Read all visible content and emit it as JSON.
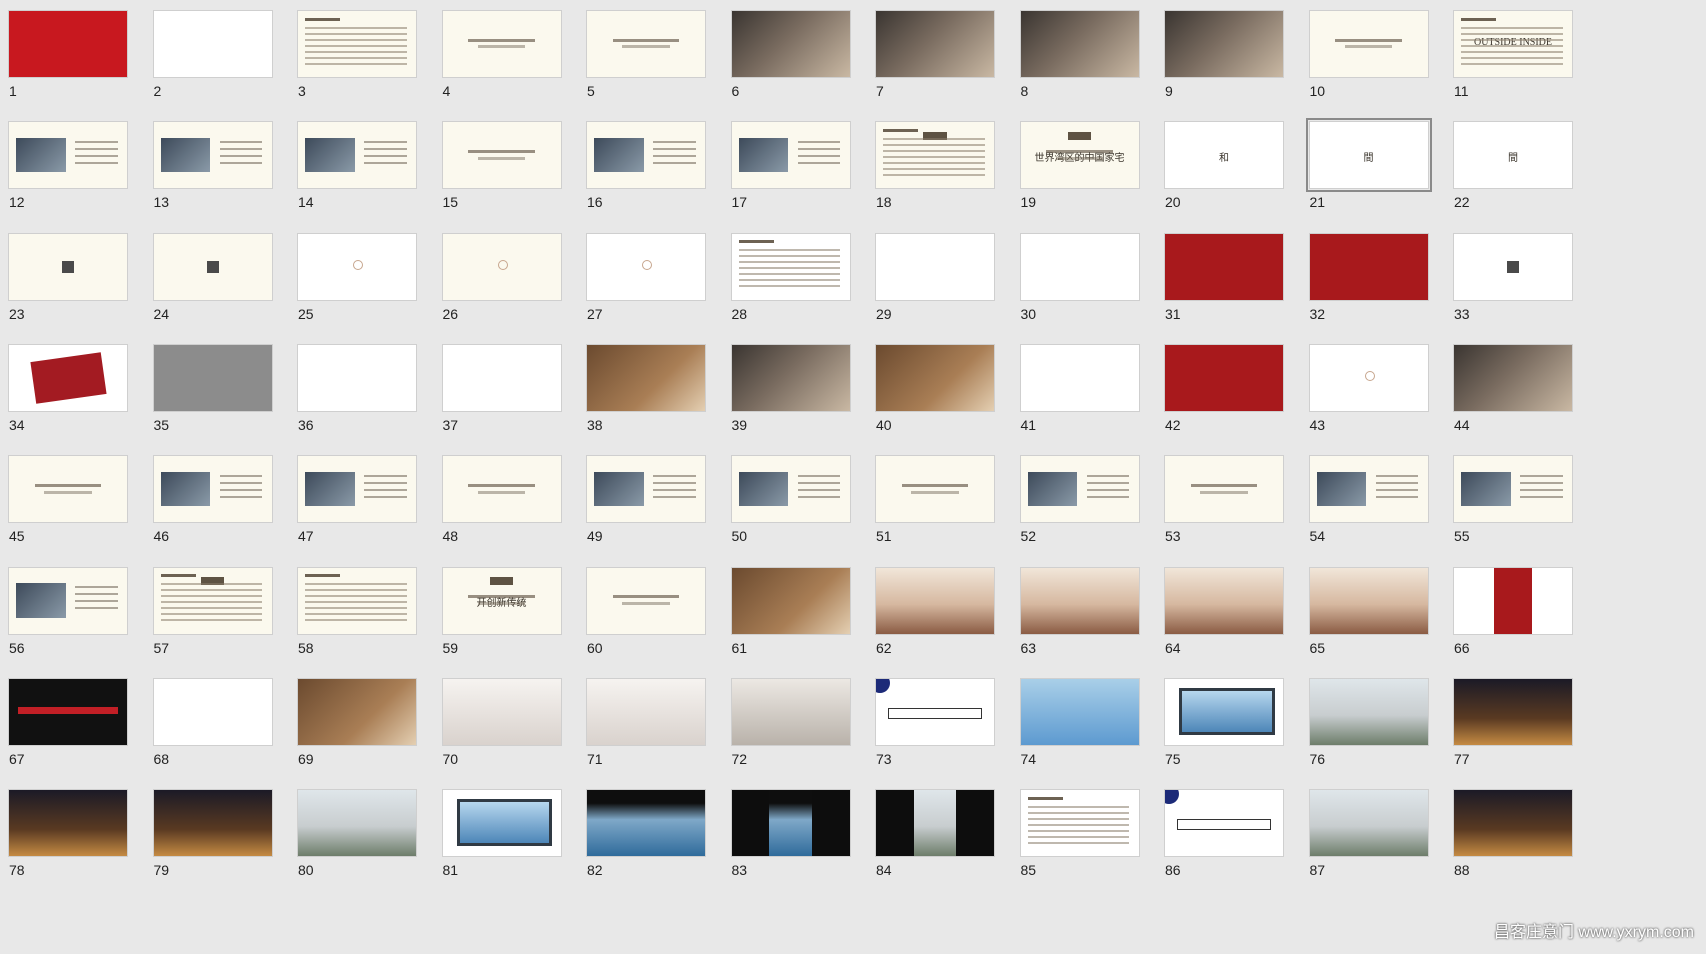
{
  "slides": [
    {
      "n": "1",
      "style": "red"
    },
    {
      "n": "2",
      "style": "white"
    },
    {
      "n": "3",
      "style": "doc"
    },
    {
      "n": "4",
      "style": "txt"
    },
    {
      "n": "5",
      "style": "txt"
    },
    {
      "n": "6",
      "style": "photo"
    },
    {
      "n": "7",
      "style": "photo"
    },
    {
      "n": "8",
      "style": "photo"
    },
    {
      "n": "9",
      "style": "photo"
    },
    {
      "n": "10",
      "style": "txt"
    },
    {
      "n": "11",
      "style": "doc",
      "text": "OUTSIDE INSIDE"
    },
    {
      "n": "12",
      "style": "pic"
    },
    {
      "n": "13",
      "style": "pic"
    },
    {
      "n": "14",
      "style": "pic"
    },
    {
      "n": "15",
      "style": "txt"
    },
    {
      "n": "16",
      "style": "pic"
    },
    {
      "n": "17",
      "style": "pic"
    },
    {
      "n": "18",
      "style": "doc",
      "tag": true
    },
    {
      "n": "19",
      "style": "txt",
      "tag": true,
      "text": "世界湾区的中国家宅"
    },
    {
      "n": "20",
      "style": "white",
      "text": "和"
    },
    {
      "n": "21",
      "style": "white",
      "text": "間",
      "selected": true
    },
    {
      "n": "22",
      "style": "white",
      "text": "間"
    },
    {
      "n": "23",
      "style": "icon"
    },
    {
      "n": "24",
      "style": "icon"
    },
    {
      "n": "25",
      "style": "mark white"
    },
    {
      "n": "26",
      "style": "mark"
    },
    {
      "n": "27",
      "style": "mark white"
    },
    {
      "n": "28",
      "style": "doc white"
    },
    {
      "n": "29",
      "style": "white"
    },
    {
      "n": "30",
      "style": "white"
    },
    {
      "n": "31",
      "style": "darkred"
    },
    {
      "n": "32",
      "style": "darkred"
    },
    {
      "n": "33",
      "style": "white icon"
    },
    {
      "n": "34",
      "style": "white redpic"
    },
    {
      "n": "35",
      "style": "gray"
    },
    {
      "n": "36",
      "style": "white"
    },
    {
      "n": "37",
      "style": "white"
    },
    {
      "n": "38",
      "style": "wood"
    },
    {
      "n": "39",
      "style": "photo"
    },
    {
      "n": "40",
      "style": "wood"
    },
    {
      "n": "41",
      "style": "white"
    },
    {
      "n": "42",
      "style": "darkred"
    },
    {
      "n": "43",
      "style": "white mark"
    },
    {
      "n": "44",
      "style": "photo"
    },
    {
      "n": "45",
      "style": "txt"
    },
    {
      "n": "46",
      "style": "pic"
    },
    {
      "n": "47",
      "style": "pic"
    },
    {
      "n": "48",
      "style": "txt"
    },
    {
      "n": "49",
      "style": "pic"
    },
    {
      "n": "50",
      "style": "pic"
    },
    {
      "n": "51",
      "style": "txt"
    },
    {
      "n": "52",
      "style": "pic"
    },
    {
      "n": "53",
      "style": "txt"
    },
    {
      "n": "54",
      "style": "pic"
    },
    {
      "n": "55",
      "style": "pic"
    },
    {
      "n": "56",
      "style": "pic"
    },
    {
      "n": "57",
      "style": "doc",
      "tag": true
    },
    {
      "n": "58",
      "style": "doc"
    },
    {
      "n": "59",
      "style": "txt",
      "tag": true,
      "text": "开创新传统"
    },
    {
      "n": "60",
      "style": "txt"
    },
    {
      "n": "61",
      "style": "wood"
    },
    {
      "n": "62",
      "style": "fac"
    },
    {
      "n": "63",
      "style": "fac"
    },
    {
      "n": "64",
      "style": "fac"
    },
    {
      "n": "65",
      "style": "fac"
    },
    {
      "n": "66",
      "style": "white redband"
    },
    {
      "n": "67",
      "style": "black blackbar"
    },
    {
      "n": "68",
      "style": "white"
    },
    {
      "n": "69",
      "style": "wood"
    },
    {
      "n": "70",
      "style": "room"
    },
    {
      "n": "71",
      "style": "room"
    },
    {
      "n": "72",
      "style": "hall"
    },
    {
      "n": "73",
      "style": "white bluecorner"
    },
    {
      "n": "74",
      "style": "sky"
    },
    {
      "n": "75",
      "style": "white panel"
    },
    {
      "n": "76",
      "style": "wall"
    },
    {
      "n": "77",
      "style": "night"
    },
    {
      "n": "78",
      "style": "night"
    },
    {
      "n": "79",
      "style": "night"
    },
    {
      "n": "80",
      "style": "wall"
    },
    {
      "n": "81",
      "style": "white panel"
    },
    {
      "n": "82",
      "style": "sea"
    },
    {
      "n": "83",
      "style": "sea doubleblack"
    },
    {
      "n": "84",
      "style": "wall doubleblack"
    },
    {
      "n": "85",
      "style": "doc white"
    },
    {
      "n": "86",
      "style": "white bluecorner"
    },
    {
      "n": "87",
      "style": "wall"
    },
    {
      "n": "88",
      "style": "night"
    }
  ],
  "watermark": "昌客庄意门 www.yxrym.com"
}
